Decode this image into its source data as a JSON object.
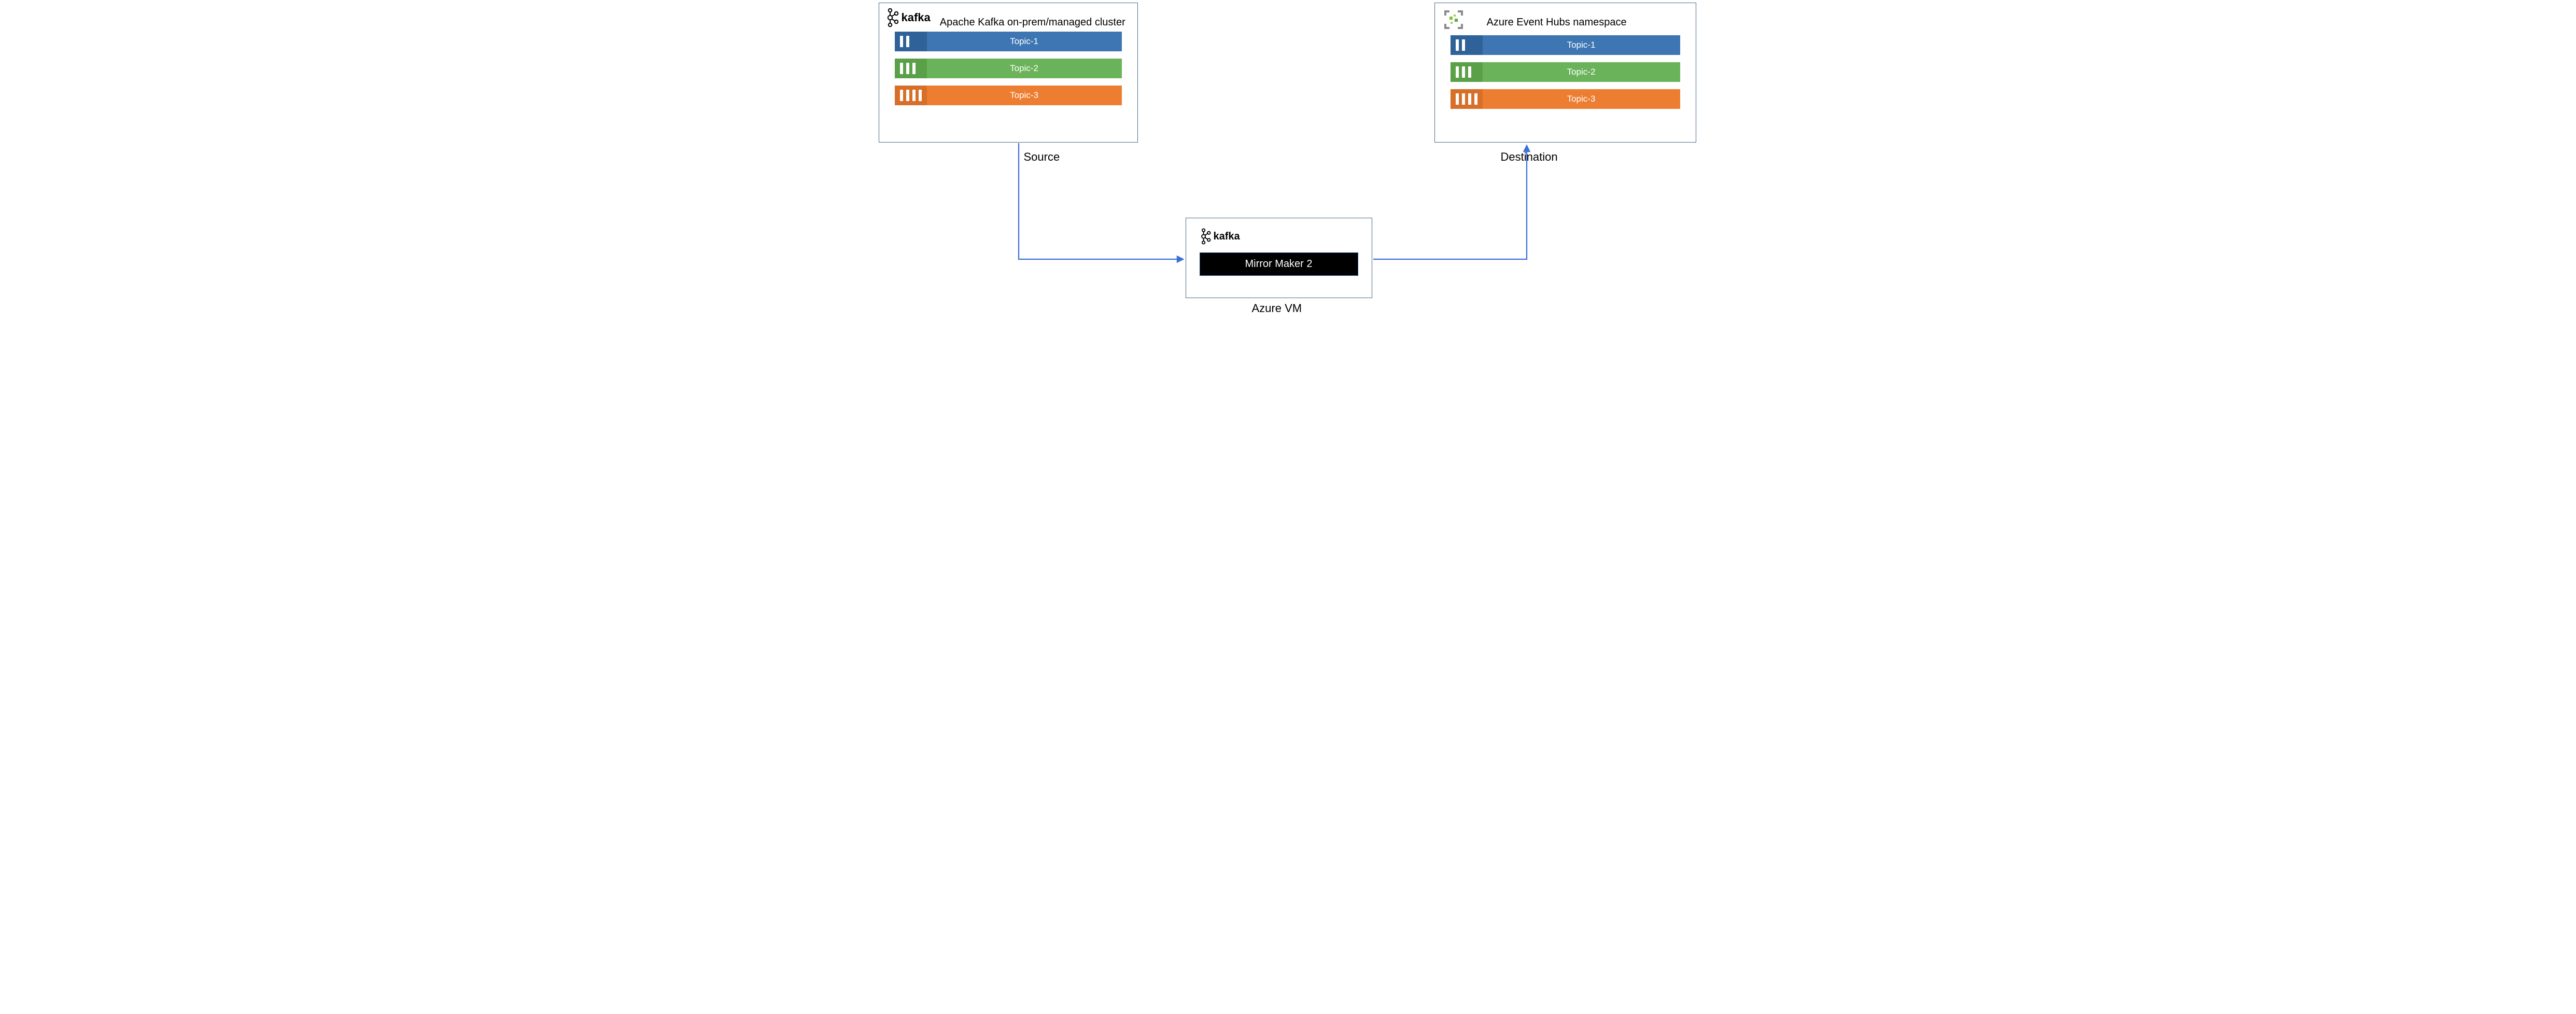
{
  "source": {
    "logo_text": "kafka",
    "title": "Apache Kafka on-prem/managed cluster",
    "role_label": "Source",
    "topics": [
      {
        "label": "Topic-1",
        "color": "blue",
        "partitions": 2
      },
      {
        "label": "Topic-2",
        "color": "green",
        "partitions": 3
      },
      {
        "label": "Topic-3",
        "color": "orange",
        "partitions": 4
      }
    ]
  },
  "destination": {
    "title": "Azure Event Hubs namespace",
    "role_label": "Destination",
    "topics": [
      {
        "label": "Topic-1",
        "color": "blue",
        "partitions": 2
      },
      {
        "label": "Topic-2",
        "color": "green",
        "partitions": 3
      },
      {
        "label": "Topic-3",
        "color": "orange",
        "partitions": 4
      }
    ]
  },
  "middle": {
    "logo_text": "kafka",
    "pill_label": "Mirror Maker 2",
    "caption": "Azure VM"
  },
  "colors": {
    "arrow": "#3a6fd8",
    "box_border": "#4a6b8a",
    "topic_blue": "#3d76b3",
    "topic_green": "#6bb35a",
    "topic_orange": "#ed7d31",
    "eventhubs_accent": "#8bc34a",
    "eventhubs_frame": "#8a8a8a"
  }
}
